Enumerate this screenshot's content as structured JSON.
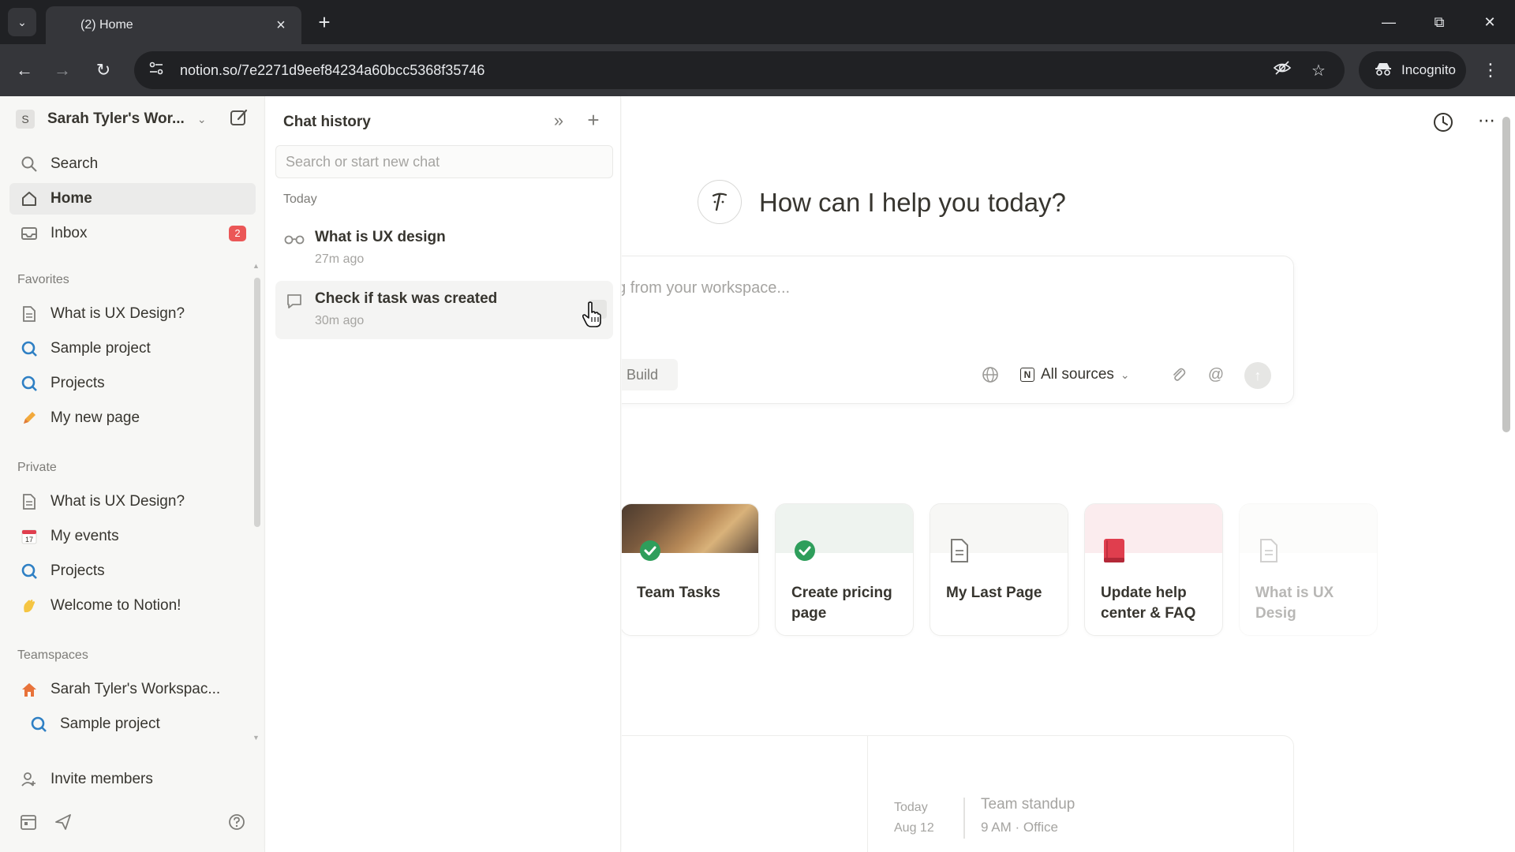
{
  "browser": {
    "tab_title": "(2) Home",
    "url": "notion.so/7e2271d9eef84234a60bcc5368f35746",
    "incognito_label": "Incognito"
  },
  "sidebar": {
    "workspace_initial": "S",
    "workspace_name": "Sarah Tyler's Wor...",
    "top_items": [
      {
        "label": "Search",
        "icon": "search-icon"
      },
      {
        "label": "Home",
        "icon": "home-icon"
      },
      {
        "label": "Inbox",
        "icon": "inbox-icon",
        "badge": "2"
      }
    ],
    "favorites_label": "Favorites",
    "favorites": [
      {
        "label": "What is UX Design?",
        "icon": "page-icon"
      },
      {
        "label": "Sample project",
        "icon": "database-icon"
      },
      {
        "label": "Projects",
        "icon": "database-icon"
      },
      {
        "label": "My new page",
        "icon": "pencil-icon"
      }
    ],
    "private_label": "Private",
    "private": [
      {
        "label": "What is UX Design?",
        "icon": "page-icon"
      },
      {
        "label": "My events",
        "icon": "calendar-icon",
        "calendar_day": "17"
      },
      {
        "label": "Projects",
        "icon": "database-icon"
      },
      {
        "label": "Welcome to Notion!",
        "icon": "wave-icon"
      }
    ],
    "teamspaces_label": "Teamspaces",
    "teamspaces": [
      {
        "label": "Sarah Tyler's Workspac...",
        "icon": "house-icon"
      },
      {
        "label": "Sample project",
        "icon": "database-icon"
      }
    ],
    "invite_label": "Invite members"
  },
  "chat_history": {
    "title": "Chat history",
    "search_placeholder": "Search or start new chat",
    "group_label": "Today",
    "items": [
      {
        "title": "What is UX design",
        "time": "27m ago",
        "icon": "glasses-icon"
      },
      {
        "title": "Check if task was created",
        "time": "30m ago",
        "icon": "chat-bubble-icon"
      }
    ]
  },
  "main": {
    "greeting": "How can I help you today?",
    "prompt_placeholder": "ng from your workspace...",
    "build_label": "Build",
    "sources_label": "All sources",
    "cards": [
      {
        "title": "Team Tasks",
        "icon": "check-circle-icon"
      },
      {
        "title": "Create pricing page",
        "icon": "check-circle-icon"
      },
      {
        "title": "My Last Page",
        "icon": "page-icon"
      },
      {
        "title": "Update help center & FAQ",
        "icon": "book-icon"
      },
      {
        "title": "What is UX Desig",
        "icon": "page-icon"
      }
    ],
    "calendar": {
      "day_label": "Today",
      "date_label": "Aug 12",
      "event_title": "Team standup",
      "event_sub": "9 AM · Office"
    }
  },
  "colors": {
    "sidebar_bg": "#f7f7f5",
    "badge_red": "#eb5757",
    "check_green": "#2e9e5b",
    "book_red": "#e03e4e",
    "chrome_dark": "#202124"
  }
}
